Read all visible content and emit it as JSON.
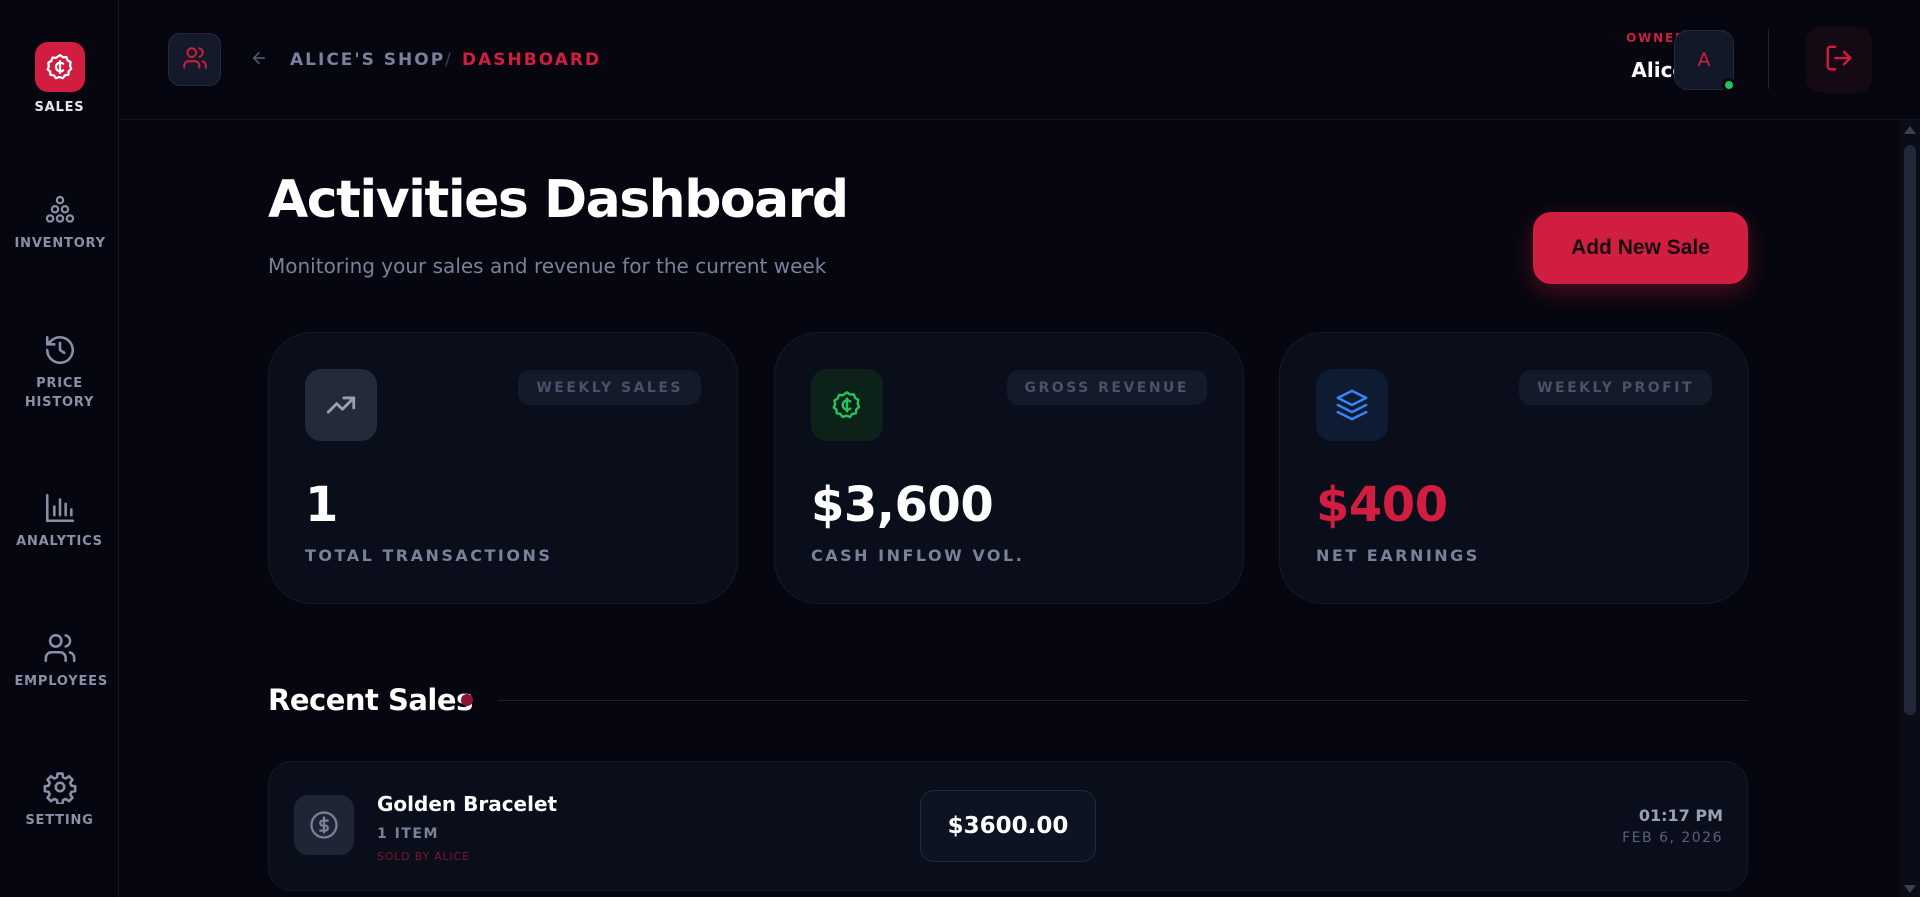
{
  "sidebar": {
    "items": [
      {
        "label": "SALES",
        "icon": "coin-badge-icon",
        "active": true
      },
      {
        "label": "INVENTORY",
        "icon": "inventory-pyramid-icon"
      },
      {
        "label": "PRICE HISTORY",
        "icon": "history-clock-icon"
      },
      {
        "label": "ANALYTICS",
        "icon": "bar-chart-icon"
      },
      {
        "label": "EMPLOYEES",
        "icon": "users-icon"
      },
      {
        "label": "SETTING",
        "icon": "gear-icon"
      }
    ]
  },
  "header": {
    "breadcrumb": {
      "shop": "ALICE'S SHOP",
      "separator": "/",
      "current": "DASHBOARD"
    },
    "owner": {
      "role": "OWNER",
      "name": "Alice",
      "initial": "A",
      "status": "online"
    }
  },
  "main": {
    "title": "Activities Dashboard",
    "subtitle": "Monitoring your sales and revenue for the current week",
    "add_button_label": "Add New Sale",
    "cards": [
      {
        "badge": "WEEKLY SALES",
        "value": "1",
        "label": "TOTAL TRANSACTIONS",
        "icon": "trending-up-icon"
      },
      {
        "badge": "GROSS REVENUE",
        "value": "$3,600",
        "label": "CASH INFLOW VOL.",
        "icon": "coin-badge-icon"
      },
      {
        "badge": "WEEKLY PROFIT",
        "value": "$400",
        "label": "NET EARNINGS",
        "icon": "layers-icon"
      }
    ],
    "recent_sales": {
      "title": "Recent Sales",
      "items": [
        {
          "name": "Golden Bracelet",
          "quantity": "1 ITEM",
          "seller": "SOLD BY ALICE",
          "amount": "$3600.00",
          "time": "01:17 PM",
          "date": "FEB 6, 2026"
        }
      ]
    }
  },
  "colors": {
    "accent": "#d11d3f",
    "background": "#05060f",
    "card": "#0a0d1a",
    "success": "#22c55e",
    "info": "#3b82f6"
  }
}
